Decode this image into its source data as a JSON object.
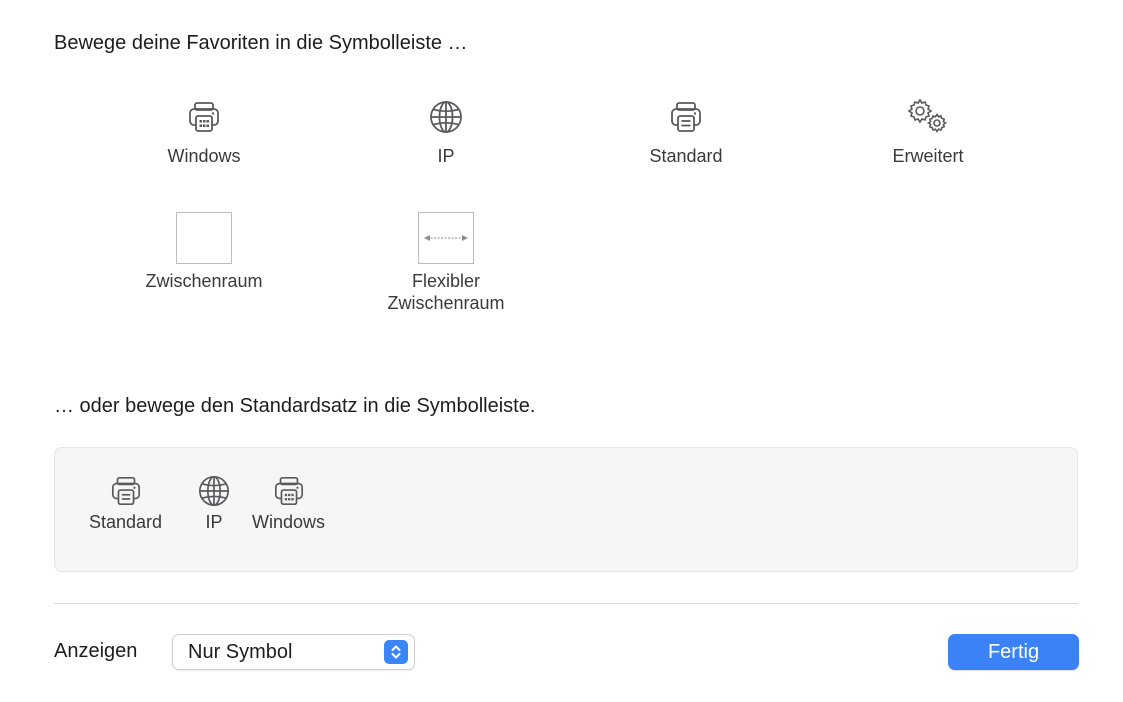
{
  "headings": {
    "favorites": "Bewege deine Favoriten in die Symbolleiste …",
    "default_set": "… oder bewege den Standardsatz in die Symbolleiste."
  },
  "palette": [
    {
      "label": "Windows",
      "icon": "printer-windows-icon"
    },
    {
      "label": "IP",
      "icon": "globe-icon"
    },
    {
      "label": "Standard",
      "icon": "printer-icon"
    },
    {
      "label": "Erweitert",
      "icon": "gears-icon"
    },
    {
      "label": "Zwischenraum",
      "icon": "space-icon"
    },
    {
      "label": "Flexibler\nZwischenraum",
      "icon": "flexible-space-icon"
    }
  ],
  "default_set": [
    {
      "label": "Standard",
      "icon": "printer-icon"
    },
    {
      "label": "IP",
      "icon": "globe-icon"
    },
    {
      "label": "Windows",
      "icon": "printer-windows-icon"
    }
  ],
  "footer": {
    "show_label": "Anzeigen",
    "show_select_value": "Nur Symbol",
    "done_label": "Fertig"
  },
  "colors": {
    "accent": "#3b82f6",
    "icon": "#5a5a5e"
  }
}
